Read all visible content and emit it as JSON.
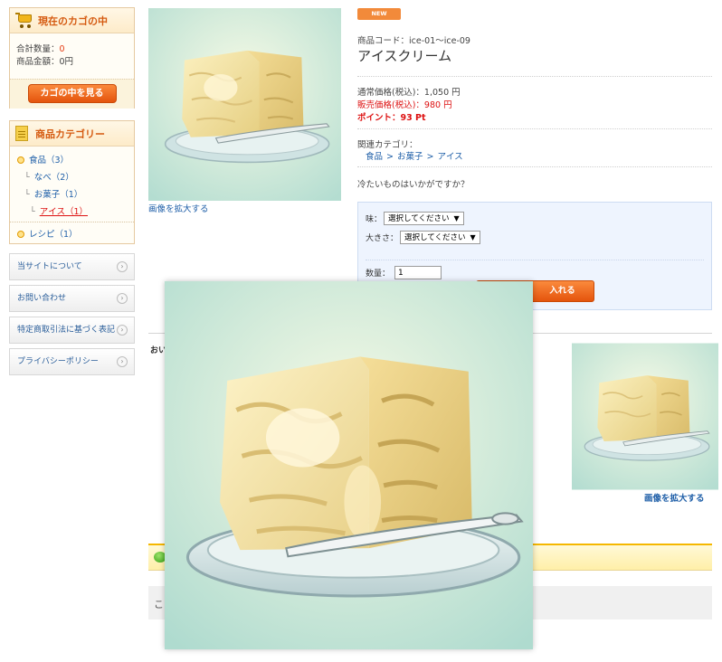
{
  "sidebar": {
    "cart": {
      "title": "現在のカゴの中",
      "count_label": "合計数量：",
      "count_value": "0",
      "amount_label": "商品金額：",
      "amount_value": "0円",
      "view_button": "カゴの中を見る"
    },
    "categories": {
      "title": "商品カテゴリー",
      "items": [
        {
          "label": "食品（3）"
        },
        {
          "label": "なべ（2）"
        },
        {
          "label": "お菓子（1）"
        },
        {
          "label": "アイス（1）"
        },
        {
          "label": "レシピ（1）"
        }
      ]
    },
    "links": [
      {
        "label": "当サイトについて"
      },
      {
        "label": "お問い合わせ"
      },
      {
        "label": "特定商取引法に基づく表記"
      },
      {
        "label": "プライバシーポリシー"
      }
    ]
  },
  "product": {
    "badge": "NEW",
    "code_label": "商品コード：",
    "code_value": "ice-01〜ice-09",
    "title": "アイスクリーム",
    "regular_price_label": "通常価格(税込)：",
    "regular_price_value": "1,050 円",
    "sale_price_label": "販売価格(税込)：",
    "sale_price_value": "980 円",
    "points_label": "ポイント：",
    "points_value": "93 Pt",
    "related_label": "関連カテゴリ：",
    "related_path": [
      "食品",
      "お菓子",
      "アイス"
    ],
    "path_separator": ">",
    "description": "冷たいものはいかがですか？",
    "enlarge_link": "画像を拡大する",
    "options": {
      "flavor_label": "味：",
      "flavor_value": "選択してください",
      "size_label": "大きさ：",
      "size_value": "選択してください",
      "qty_label": "数量：",
      "qty_value": "1",
      "add_button": "入れる"
    }
  },
  "lower": {
    "subheading": "おい",
    "enlarge_link": "画像を拡大する",
    "gray_text": "こ"
  },
  "colors": {
    "accent_orange": "#e4540d",
    "price_red": "#dd1111",
    "link_blue": "#1f5fa8"
  }
}
